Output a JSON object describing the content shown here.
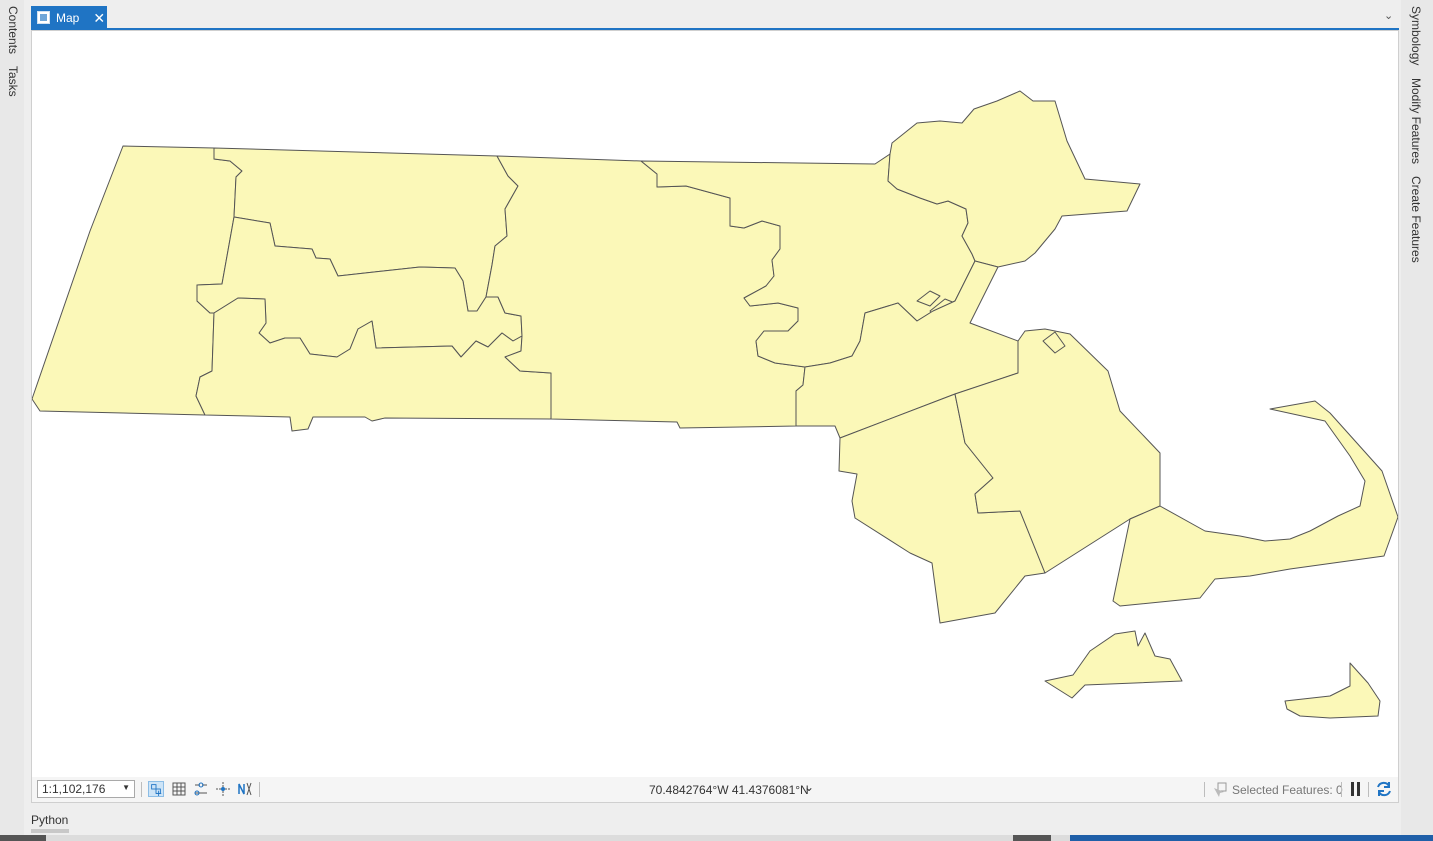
{
  "left_panel": {
    "tabs": [
      {
        "label": "Contents"
      },
      {
        "label": "Tasks"
      }
    ]
  },
  "right_panel": {
    "tabs": [
      {
        "label": "Symbology"
      },
      {
        "label": "Modify Features"
      },
      {
        "label": "Create Features"
      }
    ]
  },
  "view_tab": {
    "label": "Map",
    "close": "✕",
    "overflow": "⌄"
  },
  "map": {
    "feature_fill": "#fbf8b8",
    "feature_outline": "#555555",
    "background": "#ffffff"
  },
  "status_bar": {
    "scale": "1:1,102,176",
    "coordinates": "70.4842764°W 41.4376081°N",
    "selected_features": "Selected Features: 0"
  },
  "bottom_panel": {
    "tab": "Python"
  },
  "colors": {
    "accent": "#1f74c4"
  }
}
